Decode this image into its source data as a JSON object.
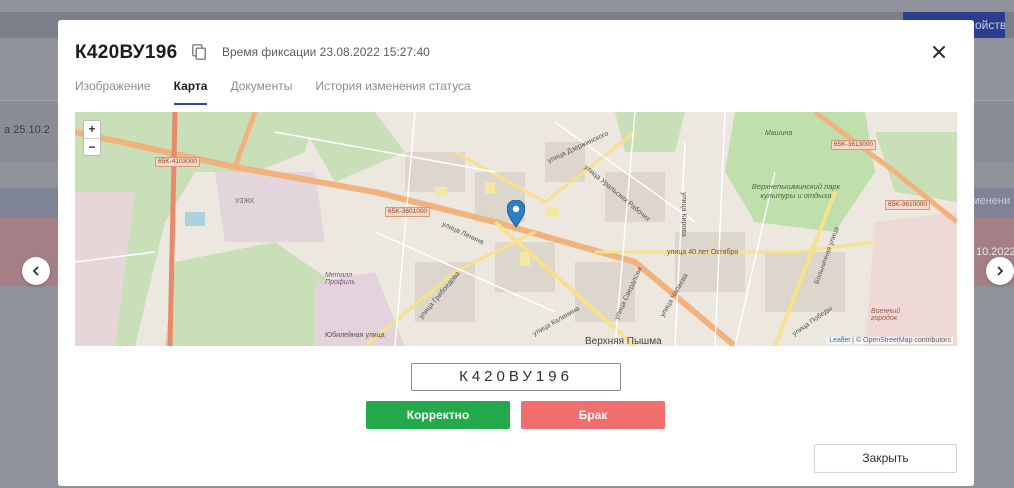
{
  "background": {
    "header_button": "ойства",
    "row_left_text": "а 25.10.2",
    "row_right_text_1": "менени",
    "row_right_text_2": "10.2022"
  },
  "modal": {
    "plate_number": "К420ВУ196",
    "fixation_time": "Время фиксации 23.08.2022 15:27:40",
    "tabs": [
      {
        "label": "Изображение",
        "active": false
      },
      {
        "label": "Карта",
        "active": true
      },
      {
        "label": "Документы",
        "active": false
      },
      {
        "label": "История изменения статуса",
        "active": false
      }
    ],
    "map": {
      "zoom_in": "+",
      "zoom_out": "−",
      "labels": {
        "road_1": "65K-4103000",
        "road_2": "65K-3601000",
        "road_3": "65K-3613000",
        "road_4": "65K-3610000",
        "park": "Верхнепышминский парк культуры и отдыха",
        "mashina": "Машина",
        "metal": "Металл Профиль",
        "uzhk": "УЗЖК",
        "military": "Военный городок",
        "street_dzerzhinskogo": "улица Дзержинского",
        "street_uralskikh": "улица Уральских Рабочих",
        "street_40let": "улица 40 лет Октября",
        "street_chapaeva": "улица Чапаева",
        "street_kalinina": "улица Калинина",
        "street_sverdlova": "улица Свердлова",
        "street_kirova": "улица Кирова",
        "street_pobedy": "улица Победы",
        "street_bolnichnaya": "Больничная улица",
        "street_griboedova": "улица Грибоедова",
        "street_lenina": "улица Ленина",
        "street_yubileynaya": "Юбилейная улица",
        "city_name": "Верхняя Пышма"
      },
      "attribution_leaflet": "Leaflet",
      "attribution_sep": " | © ",
      "attribution_osm": "OpenStreetMap",
      "attribution_tail": " contributors"
    },
    "plate_display": "К420ВУ196",
    "btn_correct": "Корректно",
    "btn_defect": "Брак",
    "btn_close": "Закрыть"
  },
  "colors": {
    "accent": "#2f46a8",
    "ok": "#21a94a",
    "defect": "#f26e6e",
    "marker": "#2f7fc6"
  },
  "icons": [
    "copy-icon",
    "close-icon",
    "map-marker-icon",
    "chevron-left-icon",
    "chevron-right-icon"
  ]
}
